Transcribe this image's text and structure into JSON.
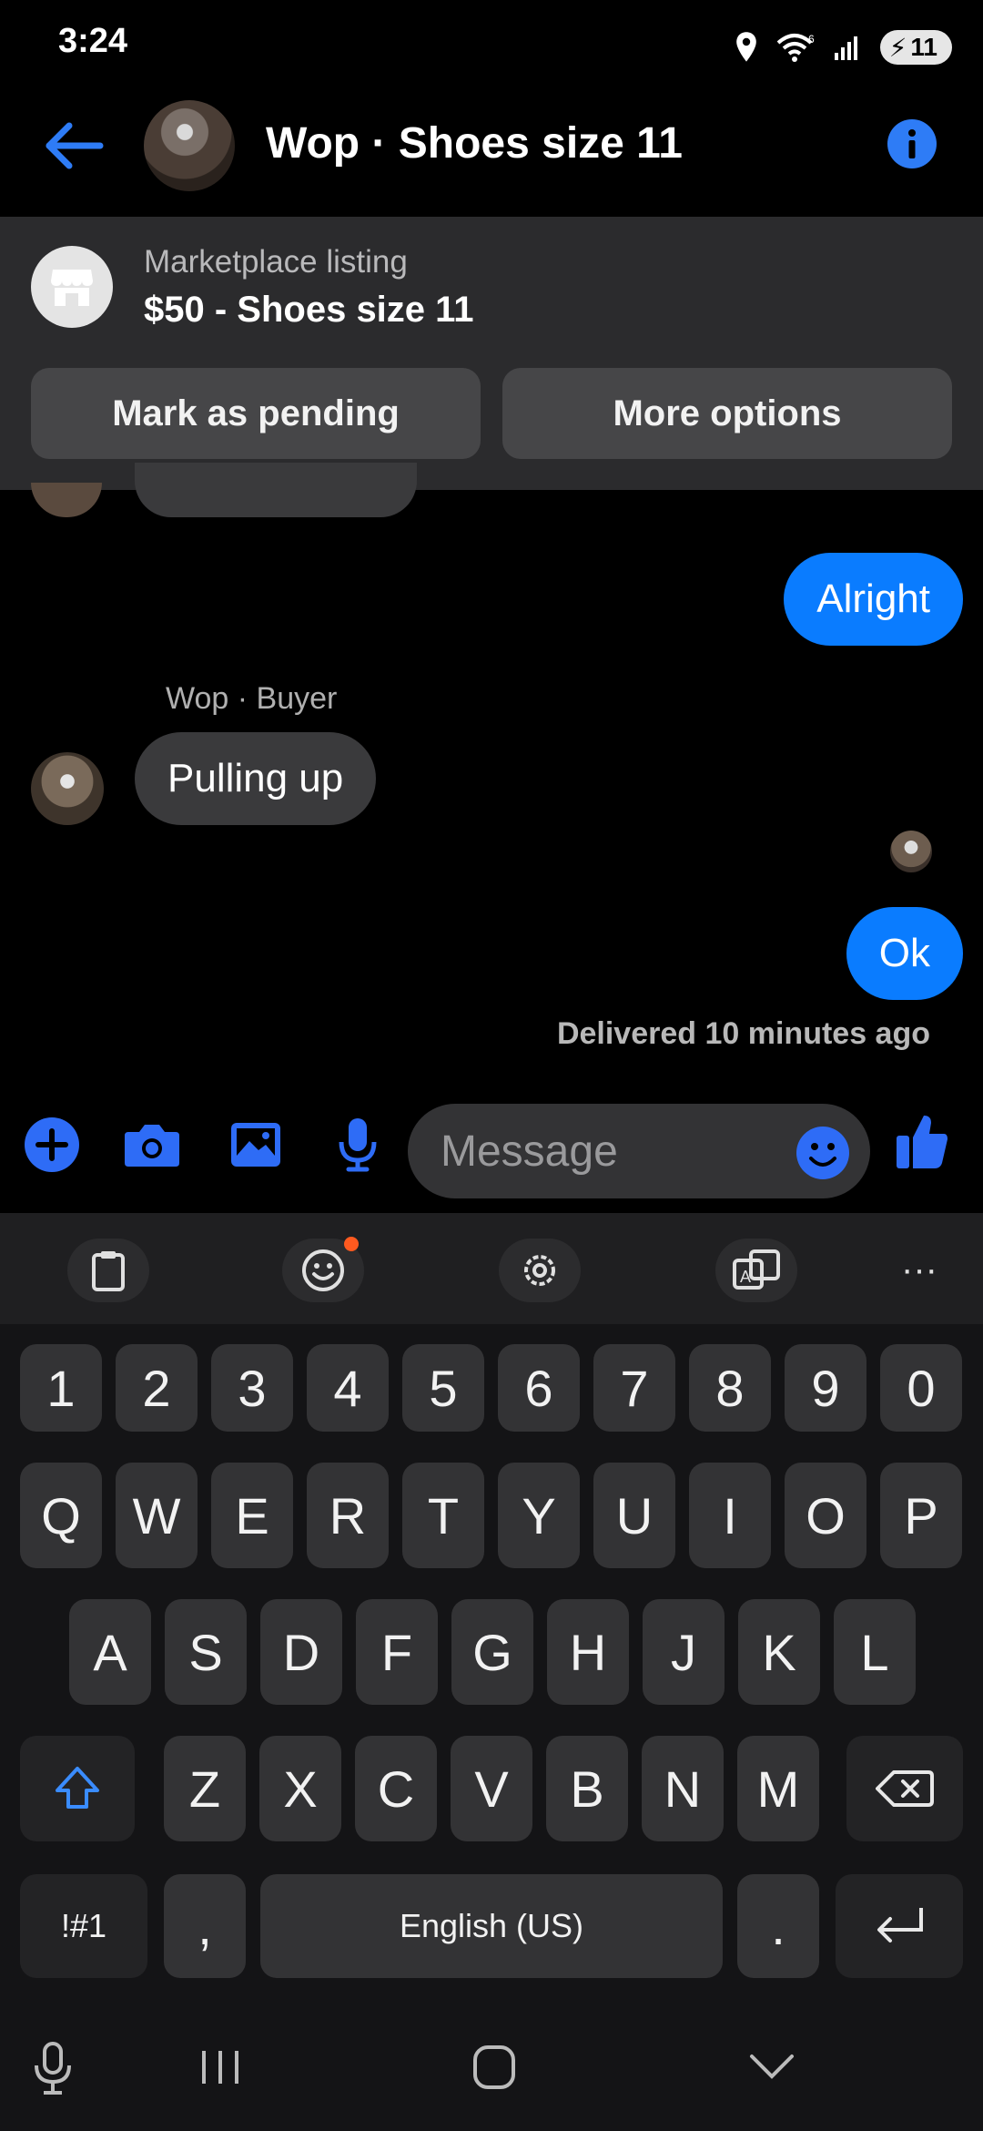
{
  "status_bar": {
    "time": "3:24",
    "battery": "11"
  },
  "header": {
    "title": "Wop · Shoes size 11"
  },
  "listing": {
    "label": "Marketplace listing",
    "title": "$50 - Shoes size 11",
    "mark_pending": "Mark as pending",
    "more_options": "More options"
  },
  "messages": {
    "alright": "Alright",
    "sender": "Wop · Buyer",
    "pulling_up": "Pulling up",
    "ok": "Ok",
    "delivered": "Delivered 10 minutes ago"
  },
  "composer": {
    "placeholder": "Message"
  },
  "keyboard": {
    "numbers": [
      "1",
      "2",
      "3",
      "4",
      "5",
      "6",
      "7",
      "8",
      "9",
      "0"
    ],
    "row1": [
      "Q",
      "W",
      "E",
      "R",
      "T",
      "Y",
      "U",
      "I",
      "O",
      "P"
    ],
    "row2": [
      "A",
      "S",
      "D",
      "F",
      "G",
      "H",
      "J",
      "K",
      "L"
    ],
    "row3": [
      "Z",
      "X",
      "C",
      "V",
      "B",
      "N",
      "M"
    ],
    "symbols": "!#1",
    "comma": ",",
    "space": "English (US)",
    "period": "."
  },
  "colors": {
    "accent": "#0a7cff",
    "icon_blue": "#2e6cf6",
    "background": "#000000"
  }
}
